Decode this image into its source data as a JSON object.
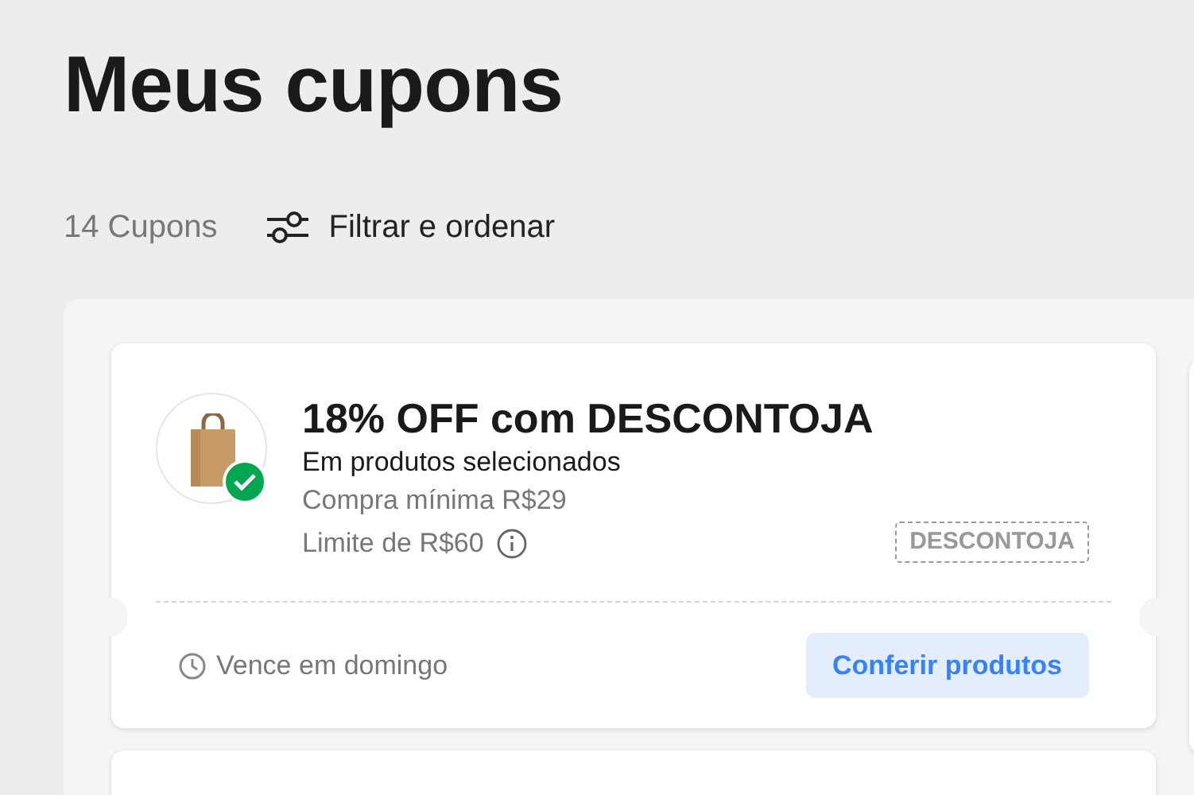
{
  "page_title": "Meus cupons",
  "coupon_count": "14 Cupons",
  "filter_button": "Filtrar e ordenar",
  "coupons": [
    {
      "title": "18% OFF com DESCONTOJA",
      "subtitle": "Em produtos selecionados",
      "minimum": "Compra mínima R$29",
      "limit": "Limite de R$60",
      "code": "DESCONTOJA",
      "activated": true,
      "expiry": "Vence em domingo",
      "action": "Conferir produtos"
    }
  ]
}
